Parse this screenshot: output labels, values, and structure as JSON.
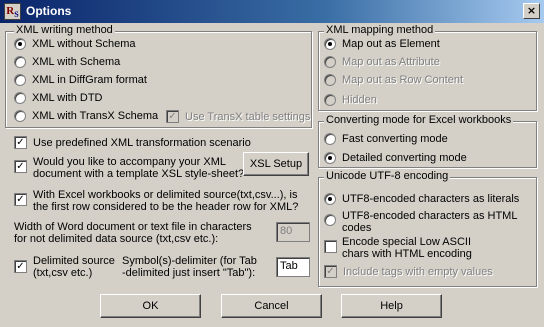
{
  "window": {
    "title": "Options",
    "icon_text": "RS",
    "close_glyph": "×"
  },
  "xml_writing": {
    "title": "XML writing method",
    "options": [
      {
        "label": "XML without Schema",
        "selected": true
      },
      {
        "label": "XML with Schema",
        "selected": false
      },
      {
        "label": "XML in DiffGram format",
        "selected": false
      },
      {
        "label": "XML with DTD",
        "selected": false
      },
      {
        "label": "XML with TransX Schema",
        "selected": false
      }
    ],
    "use_transx_label": "Use TransX table settings"
  },
  "xml_mapping": {
    "title": "XML mapping method",
    "options": [
      {
        "label": "Map out as Element",
        "selected": true,
        "enabled": true
      },
      {
        "label": "Map out as Attribute",
        "selected": false,
        "enabled": false
      },
      {
        "label": "Map out as Row Content",
        "selected": false,
        "enabled": false
      },
      {
        "label": "Hidden",
        "selected": false,
        "enabled": false
      }
    ]
  },
  "converting_mode": {
    "title": "Converting mode for Excel workbooks",
    "options": [
      {
        "label": "Fast converting mode",
        "selected": false
      },
      {
        "label": "Detailed converting mode",
        "selected": true
      }
    ]
  },
  "unicode": {
    "title": "Unicode UTF-8 encoding",
    "options": [
      {
        "label": "UTF8-encoded characters as literals",
        "selected": true
      },
      {
        "label_line1": "UTF8-encoded characters as HTML",
        "label_line2": "codes",
        "selected": false
      }
    ],
    "encode_low_ascii_line1": "Encode special Low ASCII",
    "encode_low_ascii_line2": "chars with HTML encoding",
    "include_empty_tags": "Include tags with empty values"
  },
  "settings": {
    "predefined_scenario": "Use predefined XML transformation scenario",
    "accompany_line1": "Would you like to accompany your XML",
    "accompany_line2": "document with a template XSL style-sheet?",
    "xsl_setup": "XSL Setup",
    "header_row_line1": "With Excel workbooks or delimited source(txt,csv...), is",
    "header_row_line2": "the first row considered to be the header row for XML?",
    "width_line1": "Width of Word document or text file in characters",
    "width_line2": "for not delimited data source (txt,csv etc.):",
    "width_value": "80",
    "delimited_line1": "Delimited source",
    "delimited_line2": "(txt,csv etc.)",
    "delimiter_line1": "Symbol(s)-delimiter (for Tab",
    "delimiter_line2": "-delimited just insert \"Tab\"):",
    "delimiter_value": "Tab"
  },
  "buttons": {
    "ok": "OK",
    "cancel": "Cancel",
    "help": "Help"
  },
  "check_glyph": "✓"
}
